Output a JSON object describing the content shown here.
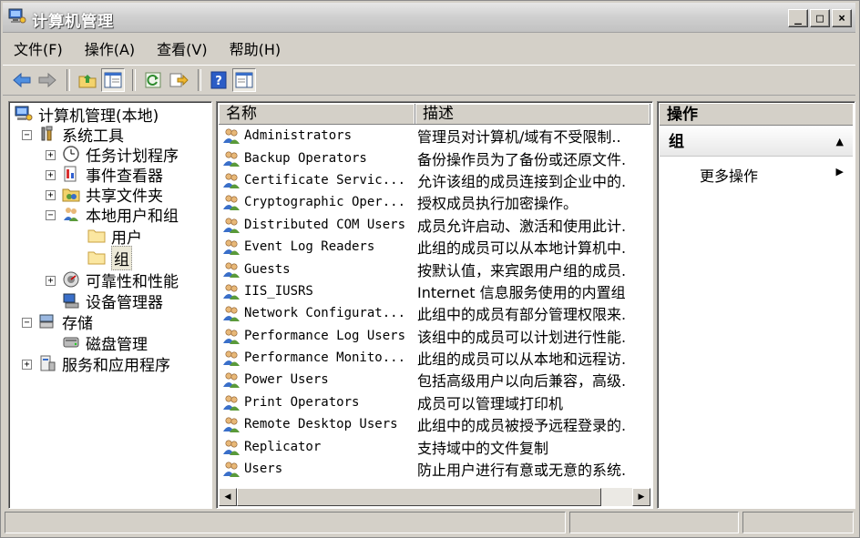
{
  "window": {
    "title": "计算机管理"
  },
  "window_buttons": {
    "minimize": "_",
    "maximize": "□",
    "close": "×"
  },
  "menu": [
    "文件(F)",
    "操作(A)",
    "查看(V)",
    "帮助(H)"
  ],
  "tree": {
    "root": "计算机管理(本地)",
    "system_tools": "系统工具",
    "task_scheduler": "任务计划程序",
    "event_viewer": "事件查看器",
    "shared_folders": "共享文件夹",
    "local_users_groups": "本地用户和组",
    "users": "用户",
    "groups": "组",
    "reliability": "可靠性和性能",
    "device_manager": "设备管理器",
    "storage": "存储",
    "disk_management": "磁盘管理",
    "services_apps": "服务和应用程序"
  },
  "list": {
    "columns": {
      "name": "名称",
      "description": "描述"
    },
    "rows": [
      {
        "name": "Administrators",
        "description": "管理员对计算机/域有不受限制.."
      },
      {
        "name": "Backup Operators",
        "description": "备份操作员为了备份或还原文件."
      },
      {
        "name": "Certificate Servic...",
        "description": "允许该组的成员连接到企业中的."
      },
      {
        "name": "Cryptographic Oper...",
        "description": "授权成员执行加密操作。"
      },
      {
        "name": "Distributed COM Users",
        "description": "成员允许启动、激活和使用此计."
      },
      {
        "name": "Event Log Readers",
        "description": "此组的成员可以从本地计算机中."
      },
      {
        "name": "Guests",
        "description": "按默认值，来宾跟用户组的成员."
      },
      {
        "name": "IIS_IUSRS",
        "description": "Internet 信息服务使用的内置组"
      },
      {
        "name": "Network Configurat...",
        "description": "此组中的成员有部分管理权限来."
      },
      {
        "name": "Performance Log Users",
        "description": "该组中的成员可以计划进行性能."
      },
      {
        "name": "Performance Monito...",
        "description": "此组的成员可以从本地和远程访."
      },
      {
        "name": "Power Users",
        "description": "包括高级用户以向后兼容，高级."
      },
      {
        "name": "Print Operators",
        "description": "成员可以管理域打印机"
      },
      {
        "name": "Remote Desktop Users",
        "description": "此组中的成员被授予远程登录的."
      },
      {
        "name": "Replicator",
        "description": "支持域中的文件复制"
      },
      {
        "name": "Users",
        "description": "防止用户进行有意或无意的系统."
      }
    ]
  },
  "actions": {
    "title": "操作",
    "group": "组",
    "more": "更多操作"
  },
  "icons": [
    "computer-management-icon",
    "back-icon",
    "forward-icon",
    "up-folder-icon",
    "show-tree-icon",
    "refresh-icon",
    "export-icon",
    "help-icon",
    "properties-icon",
    "group-icon"
  ]
}
